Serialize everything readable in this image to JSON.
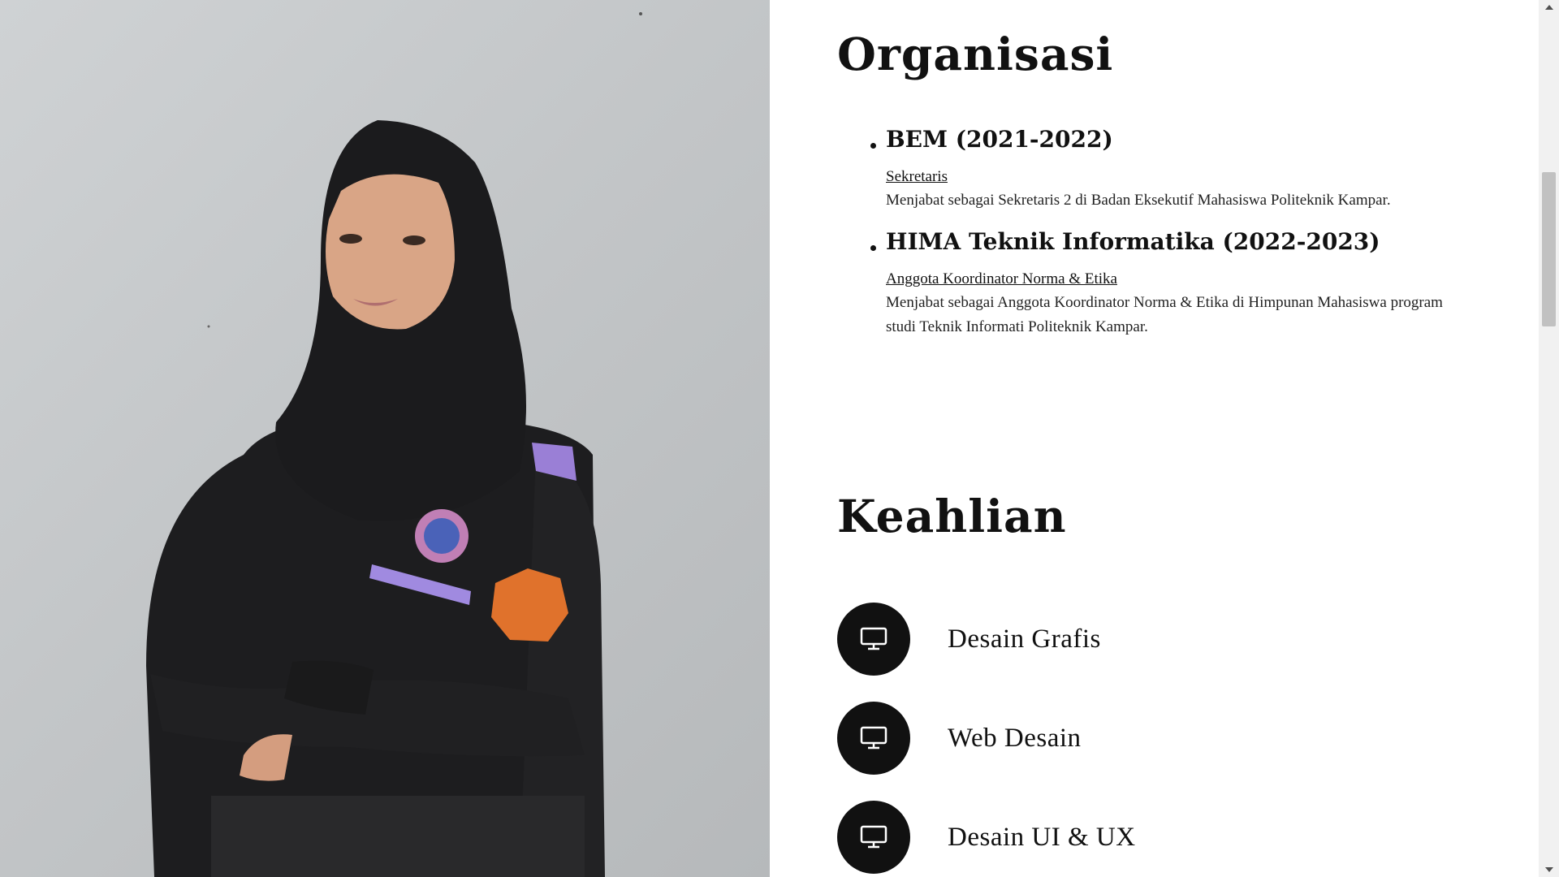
{
  "profile_photo": {
    "alt": "Portrait photo"
  },
  "organisasi": {
    "title": "Organisasi",
    "items": [
      {
        "name": "BEM (2021-2022)",
        "role": "Sekretaris",
        "description": "Menjabat sebagai Sekretaris 2 di Badan Eksekutif Mahasiswa Politeknik Kampar."
      },
      {
        "name": "HIMA Teknik Informatika (2022-2023)",
        "role": "Anggota Koordinator Norma & Etika",
        "description": "Menjabat sebagai Anggota Koordinator Norma & Etika di Himpunan Mahasiswa program studi Teknik Informati Politeknik Kampar."
      }
    ]
  },
  "keahlian": {
    "title": "Keahlian",
    "items": [
      {
        "label": "Desain Grafis",
        "icon": "monitor-icon"
      },
      {
        "label": "Web Desain",
        "icon": "monitor-icon"
      },
      {
        "label": "Desain UI & UX",
        "icon": "monitor-icon"
      }
    ]
  },
  "colors": {
    "text": "#111111",
    "icon_circle": "#111111",
    "icon_glyph": "#ffffff",
    "background": "#ffffff"
  }
}
